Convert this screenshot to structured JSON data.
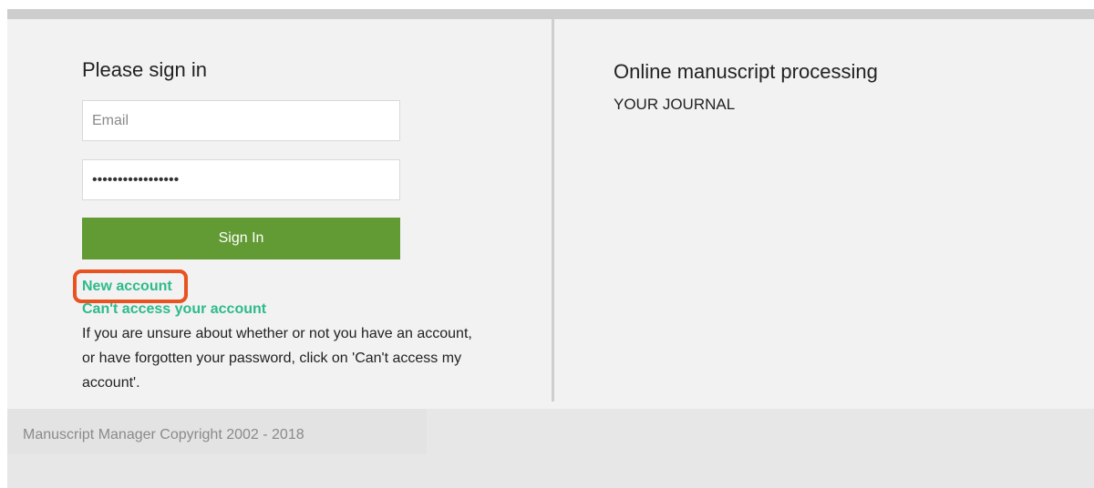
{
  "login": {
    "title": "Please sign in",
    "email_placeholder": "Email",
    "email_value": "",
    "password_value": "•••••••••••••••••",
    "signin_label": "Sign In",
    "new_account_label": "New account",
    "cant_access_label": "Can't access your account",
    "help_text": "If you are unsure about whether or not you have an account, or have forgotten your password, click on 'Can't access my account'."
  },
  "info": {
    "title": "Online manuscript processing",
    "journal": "YOUR JOURNAL"
  },
  "footer": {
    "copyright": "Manuscript Manager Copyright 2002 - 2018"
  },
  "colors": {
    "button": "#629a34",
    "link": "#2dbb8c",
    "highlight": "#e8531f"
  }
}
